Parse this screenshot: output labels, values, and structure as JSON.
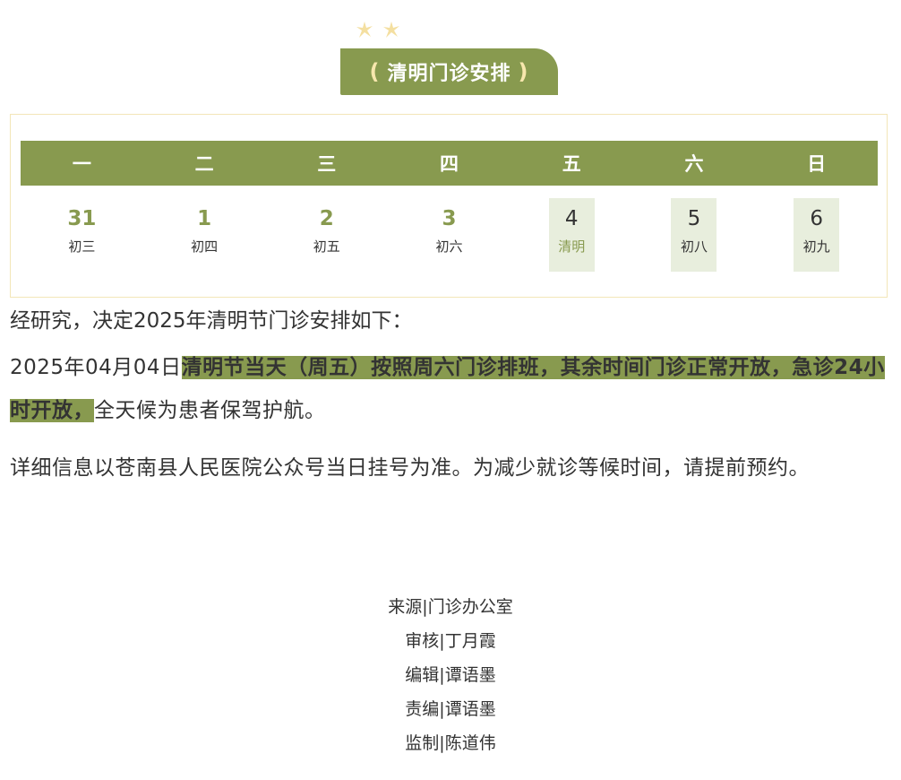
{
  "header": {
    "title": "清明门诊安排",
    "paren_open": "(",
    "paren_close": ")"
  },
  "calendar": {
    "weekdays": [
      "一",
      "二",
      "三",
      "四",
      "五",
      "六",
      "日"
    ],
    "days": [
      {
        "num": "31",
        "lunar": "初三",
        "highlight": false
      },
      {
        "num": "1",
        "lunar": "初四",
        "highlight": false
      },
      {
        "num": "2",
        "lunar": "初五",
        "highlight": false
      },
      {
        "num": "3",
        "lunar": "初六",
        "highlight": false
      },
      {
        "num": "4",
        "lunar": "清明",
        "highlight": true,
        "festival": true
      },
      {
        "num": "5",
        "lunar": "初八",
        "highlight": true
      },
      {
        "num": "6",
        "lunar": "初九",
        "highlight": true
      }
    ]
  },
  "body": {
    "intro": "经研究，决定2025年清明节门诊安排如下：",
    "date": "2025年04月04日",
    "highlight": "清明节当天（周五）按照周六门诊排班，其余时间门诊正常开放，急诊24小时开放，",
    "tail": "全天候为患者保驾护航。",
    "note": "详细信息以苍南县人民医院公众号当日挂号为准。为减少就诊等候时间，请提前预约。"
  },
  "credits": [
    "来源|门诊办公室",
    "审核|丁月霞",
    "编辑|谭语墨",
    "责编|谭语墨",
    "监制|陈道伟"
  ],
  "colors": {
    "accent": "#889a4f",
    "highlight_bg": "#e8eedd",
    "border": "#f3e6b8",
    "sparkle": "#f4dfa0"
  }
}
